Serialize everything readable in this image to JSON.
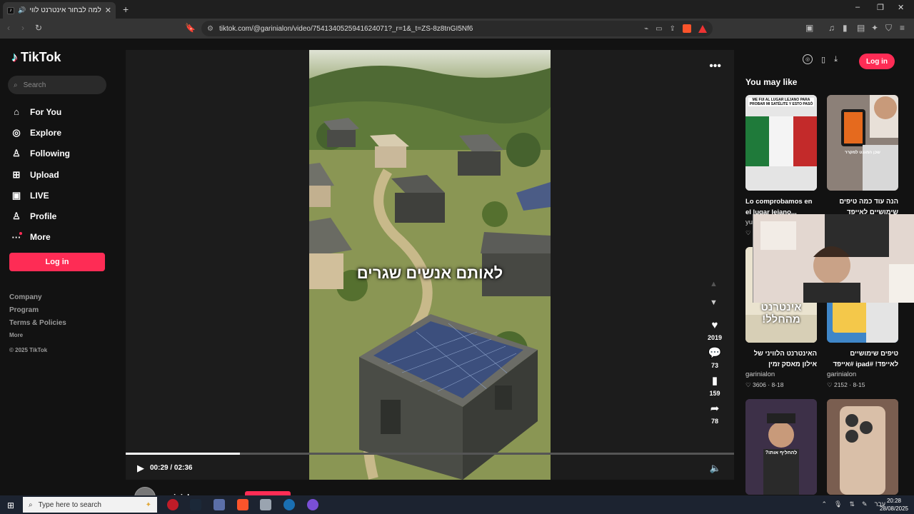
{
  "browser": {
    "tab_title": "למה לבחור אינטרנט לוויני כמ...",
    "tab_favicon": "tiktok-favicon",
    "url": "tiktok.com/@garinialon/video/7541340525941624071?_r=1&_t=ZS-8z8tnGI5Nf6",
    "window_controls": [
      "–",
      "❐",
      "✕"
    ]
  },
  "sidebar": {
    "logo_text": "TikTok",
    "search_placeholder": "Search",
    "nav": [
      {
        "label": "For You",
        "icon": "home-icon"
      },
      {
        "label": "Explore",
        "icon": "compass-icon"
      },
      {
        "label": "Following",
        "icon": "people-icon"
      },
      {
        "label": "Upload",
        "icon": "plus-square-icon"
      },
      {
        "label": "LIVE",
        "icon": "tv-icon"
      },
      {
        "label": "Profile",
        "icon": "person-icon"
      },
      {
        "label": "More",
        "icon": "dots-icon"
      }
    ],
    "login_label": "Log in",
    "footer": {
      "company": "Company",
      "program": "Program",
      "terms": "Terms & Policies",
      "more": "More",
      "copyright": "© 2025 TikTok"
    }
  },
  "video": {
    "caption": "לאותם אנשים שגרים",
    "likes": "2019",
    "comments": "73",
    "saves": "159",
    "shares": "78",
    "progress_fraction": 0.188,
    "time": "00:29 / 02:36",
    "author": "garinialon"
  },
  "topbar": {
    "login_label": "Log in"
  },
  "recommendations": {
    "heading": "You may like",
    "items": [
      {
        "title": "Lo comprobamos en el lugar lejano...",
        "author": "yu",
        "stats": "♡",
        "overlay": "ME FUI AL LUGAR LEJANO PARA PROBAR MI SATÉLITE Y ESTO PASÓ"
      },
      {
        "title": "הנה עוד כמה טיפים שימושיים לאייפד #אייפד",
        "author": "",
        "stats": "",
        "overlay": "שכן המגנט למקרר"
      },
      {
        "title": "האינטרנט הלוויני של אילון מאסק זמין בישראל",
        "author": "garinialon",
        "stats": "♡ 3606 · 8-18",
        "overlay": "אינטרנט מהחלל!"
      },
      {
        "title": "טיפים שימושיים לאייפד! #ipad #אייפד",
        "author": "garinialon",
        "stats": "♡ 2152 · 8-15",
        "overlay": ""
      },
      {
        "title": "",
        "author": "",
        "stats": "",
        "overlay": "להחליף אותו?"
      },
      {
        "title": "",
        "author": "",
        "stats": "",
        "overlay": ""
      }
    ]
  },
  "taskbar": {
    "search_placeholder": "Type here to search",
    "lang": "עבר",
    "time": "20:28",
    "date": "28/08/2025"
  }
}
